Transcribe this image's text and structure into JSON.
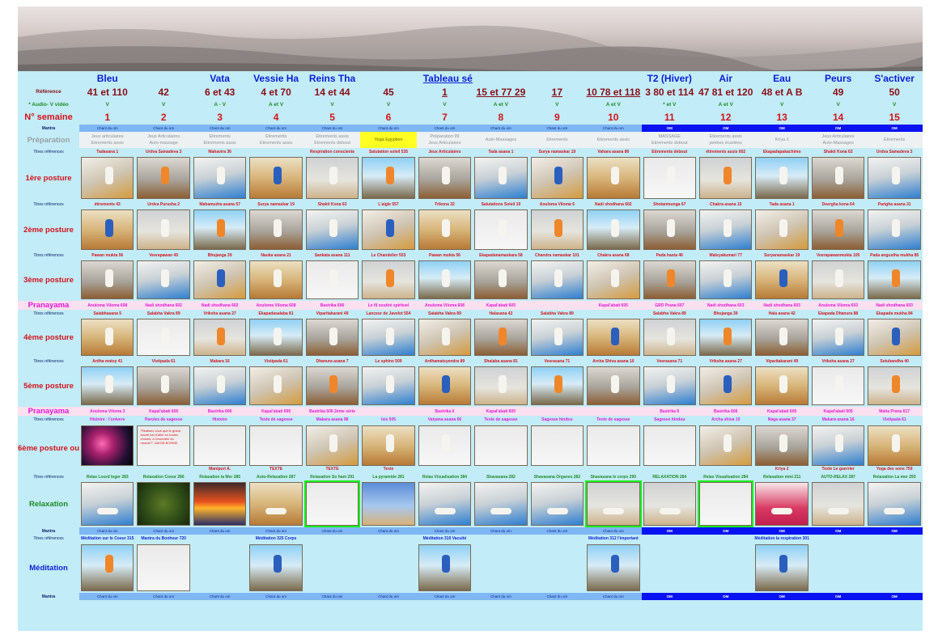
{
  "title": "Tableau séances de hatha yoga",
  "columns": [
    {
      "head": "Bleu",
      "head_color": "blue",
      "ref": "41 et 110",
      "av": "V",
      "n": "1",
      "mantra": "Chant du om",
      "prep1": "Jeux articulaires",
      "prep2": "Etirements assis",
      "t1": "Tadasana 1",
      "t2": "étirements 43",
      "t3": "Pawan mukta 56",
      "pr1": "Anuloma Viloma 608",
      "t4": "Salabhasana 5",
      "t5": "Ardha matsy 41",
      "pr2": "Anuloma Viloma 3",
      "t6": "Histoire : l'univers",
      "t6c": "",
      "t7": "Relax Lourd leger 283",
      "mantra2": "Chant du om",
      "med": "Méditation sur le Coeur 315",
      "mantra3": "Chant du om"
    },
    {
      "head": "",
      "head_color": "blue",
      "ref": "42",
      "av": "V",
      "n": "2",
      "mantra": "Chant du om",
      "prep1": "Jeux Articulaires",
      "prep2": "Auto-massage",
      "t1": "Urdva Samadeva 3",
      "t2": "Urdva Purusha 2",
      "t3": "Veerapawan 45",
      "pr1": "Nadi shodhana 602",
      "t4": "Salabha Vakra 89",
      "t5": "Vistipada 61",
      "pr2": "Kapal'abati 605",
      "t6": "Paroles de sagesse",
      "t6c": "",
      "t7": "Relaxation Coeur 286",
      "mantra2": "Chant du om",
      "med": "Mantra du Bonheur 720",
      "mantra3": "Chant du om"
    },
    {
      "head": "Vata",
      "head_color": "blue",
      "ref": "6 et 43",
      "av": "A - V",
      "n": "3",
      "mantra": "Chant du om",
      "prep1": "Etirements",
      "prep2": "Etirements assis",
      "t1": "Mahavira 36",
      "t2": "Mahamudra asana 57",
      "t3": "Bhujanga 39",
      "pr1": "Nadi shodhana 602",
      "t4": "Vriksha asana 27",
      "t5": "Makara 16",
      "pr2": "Bastrika 606",
      "t6": "Histoire",
      "t6c": "Manipuri A.",
      "t7": "Relaxation la Mer 285",
      "mantra2": "Chant du om",
      "med": "",
      "mantra3": "Chant du om"
    },
    {
      "head": "Vessie Ha",
      "head_color": "blue",
      "ref": "4 et 70",
      "av": "A et V",
      "n": "4",
      "mantra": "Chant du om",
      "prep1": "Etirements",
      "prep2": "Etirements assis",
      "t1": "",
      "t2": "Surya namaskar 19",
      "t3": "Nauka asana 21",
      "pr1": "Anuloma Viloma 608",
      "t4": "Ekapadasalaba 81",
      "t5": "Vistipada 61",
      "pr2": "Kapal'abati 605",
      "t6": "Texte de sagesse",
      "t6c": "TEXTE",
      "t7": "Auto-Relaxation 287",
      "mantra2": "Chant du om",
      "med": "Méditation 325 Corps",
      "mantra3": "Chant du om"
    },
    {
      "head": "Reins Tha",
      "head_color": "blue",
      "ref": "14 et 44",
      "av": "V",
      "n": "5",
      "mantra": "Chant du om",
      "prep1": "Etirements assis",
      "prep2": "Etirements debout",
      "t1": "Respiration consciente",
      "t2": "Shakti Kona 63",
      "t3": "Sankata asana 111",
      "pr1": "Bastrika 606",
      "t4": "Viparitakarani 49",
      "t5": "Dhanura asana 7",
      "pr2": "Bastrika 606 2ème série",
      "t6": "Makara asana 98",
      "t6c": "TEXTE",
      "t7": "Relaxation So ham 291",
      "mantra2": "Chant du om",
      "med": "",
      "mantra3": "Chant du om"
    },
    {
      "head": "",
      "head_color": "blue",
      "ref": "45",
      "av": "V",
      "n": "6",
      "mantra": "Chant du om",
      "prep1": "Yoga Egyptien",
      "prep2": "",
      "t1": "Salutation soleil 535",
      "t2": "L'aigle 557",
      "t3": "Le Chandelier 553",
      "pr1": "Le fil soutiré spirituel",
      "t4": "Lanceur de Javelot 554",
      "t5": "Le sphinx 509",
      "pr2": "",
      "t6": "Isis 505",
      "t6c": "Texte",
      "t7": "La pyramide 281",
      "mantra2": "Chant du om",
      "med": "",
      "mantra3": "Chant du om"
    },
    {
      "head": "",
      "head_color": "blue",
      "ref": "1",
      "av": "V",
      "n": "7",
      "mantra": "Chant du om",
      "prep1": "Préparation 99",
      "prep2": "Jeux Articulaires",
      "t1": "Jeux Articulaires",
      "t2": "Trikona 32",
      "t3": "Pawan mukta 56",
      "pr1": "Anuloma Viloma 608",
      "t4": "Salabha Vakra 89",
      "t5": "Ardhamatsyendra 89",
      "pr2": "Bastrika 6",
      "t6": "Vatyana asana 66",
      "t6c": "",
      "t7": "Relax Visualisation 284",
      "mantra2": "Chant du om",
      "med": "Méditation 310 Vacuité",
      "mantra3": "Chant du om"
    },
    {
      "head": "",
      "head_color": "blue",
      "ref": "15 et 77 29",
      "av": "A et V",
      "n": "8",
      "mantra": "Chant du om",
      "prep1": "Auto-Massages",
      "prep2": "",
      "t1": "Tada asana 1",
      "t2": "Salutations Soleil 19",
      "t3": "Ekapadanamaskara 58",
      "pr1": "Kapal'abati 605",
      "t4": "Halasana 42",
      "t5": "Shalaba asana 81",
      "pr2": "Kapal'abati 605",
      "t6": "Texte de sagesse",
      "t6c": "",
      "t7": "Shavasana 282",
      "mantra2": "Chant du om",
      "med": "",
      "mantra3": "Chant du om"
    },
    {
      "head": "",
      "head_color": "blue",
      "ref": "17",
      "av": "V",
      "n": "9",
      "mantra": "Chant du om",
      "prep1": "Etirements",
      "prep2": "",
      "t1": "Surya namaskar 19",
      "t2": "Anuloma Viloma 6",
      "t3": "Chandra namaskar 101",
      "pr1": "",
      "t4": "Salabha Vakra 89",
      "t5": "Veerasana 71",
      "pr2": "",
      "t6": "Sagesse hindou",
      "t6c": "",
      "t7": "Shavasana Organes 282",
      "mantra2": "Chant du om",
      "med": "",
      "mantra3": "Chant du om"
    },
    {
      "head": "",
      "head_color": "blue",
      "ref": "10 78 et 118",
      "av": "A et V",
      "n": "10",
      "mantra": "Chant du om",
      "prep1": "",
      "prep2": "Etirements assis",
      "t1": "Vahara asana 86",
      "t2": "Nadi shodhana 602",
      "t3": "Chakra asana 68",
      "pr1": "Kapal'abati 605",
      "t4": "",
      "t5": "Archa Shiva asana 10",
      "pr2": "",
      "t6": "Texte de sagesse",
      "t6c": "",
      "t7": "Shavasana le corps 290",
      "mantra2": "Chant du om",
      "med": "Méditation 312 l'important",
      "mantra3": "Chant du om"
    },
    {
      "head": "T2 (Hiver)",
      "head_color": "blue",
      "ref": "3 80 et 114",
      "av": "* et V",
      "n": "11",
      "mantra": "OM",
      "prep1": "MASSAGE",
      "prep2": "Etirements debout",
      "t1": "Etirements debout",
      "t2": "Shotanmunga 67",
      "t3": "Pada hasta 46",
      "pr1": "GRD Prana 607",
      "t4": "Salabha Vakra 89",
      "t5": "Veerasana 71",
      "pr2": "Bastrika 6",
      "t6": "Sagesse hindou",
      "t6c": "",
      "t7": "RELAXATION 284",
      "mantra2": "OM",
      "med": "",
      "mantra3": "OM"
    },
    {
      "head": "Air",
      "head_color": "blue",
      "ref": "47 81 et 120",
      "av": "A et V",
      "n": "12",
      "mantra": "OM",
      "prep1": "Etirements assis",
      "prep2": "jambes écartées",
      "t1": "étirements assis 602",
      "t2": "Chakra asana 15",
      "t3": "Matsyakumari 77",
      "pr1": "Nadi shodhana 603",
      "t4": "Bhujanga 39",
      "t5": "Vriksha asana 27",
      "pr2": "Bastrika 606",
      "t6": "Archa shiva 10",
      "t6c": "",
      "t7": "Relax Visualisation 284",
      "mantra2": "OM",
      "med": "",
      "mantra3": "OM"
    },
    {
      "head": "Eau",
      "head_color": "blue",
      "ref": "48 et A B",
      "av": "V",
      "n": "13",
      "mantra": "OM",
      "prep1": "Kriya 1",
      "prep2": "",
      "t1": "Ekapadapakachimo",
      "t2": "Tada asana 1",
      "t3": "Suryanamaskar 19",
      "pr1": "Nadi shodhana 603",
      "t4": "Hala asana 42",
      "t5": "Viparitakarani 49",
      "pr2": "Kapal'abati 605",
      "t6": "Naga asana 37",
      "t6c": "Kriya 2",
      "t7": "Relaxation mini 211",
      "mantra2": "OM",
      "med": "Méditation la respiration 301",
      "mantra3": "OM"
    },
    {
      "head": "Peurs",
      "head_color": "blue",
      "ref": "49",
      "av": "V",
      "n": "14",
      "mantra": "OM",
      "prep1": "Jeux Articulaires",
      "prep2": "Auto-Massages",
      "t1": "Shakti Kona 63",
      "t2": "Deergha kona 64",
      "t3": "Veerapawanmukta 105",
      "pr1": "Anuloma Viloma 603",
      "t4": "Ekapada Dhanura 88",
      "t5": "Vriksha asana 27",
      "pr2": "Kapal'abati 605",
      "t6": "Makara asana 16",
      "t6c": "Texte Le guerrier",
      "t7": "AUTO-RELAX 287",
      "mantra2": "OM",
      "med": "",
      "mantra3": "OM"
    },
    {
      "head": "S'activer",
      "head_color": "blue",
      "ref": "50",
      "av": "V",
      "n": "15",
      "mantra": "OM",
      "prep1": "Etirements",
      "prep2": "",
      "t1": "Urdva Samadeva 3",
      "t2": "Parigha asana 31",
      "t3": "Pada angustha mukha 85",
      "pr1": "Nadi shodhana 603",
      "t4": "Ekapada mukha 84",
      "t5": "Setubandha 40",
      "pr2": "Maha Prana 617",
      "t6": "Vistipada 61",
      "t6c": "Yoga des sons 759",
      "t7": "Relaxation La mer 293",
      "mantra2": "OM",
      "med": "",
      "mantra3": "OM"
    }
  ],
  "row_labels": {
    "reference": "Référence",
    "audio": "* Audio- V vidéo",
    "semaine": "N° semaine",
    "mantra": "Mantra",
    "preparation": "Préparation",
    "titres": "Titres références",
    "posture1": "1ère posture",
    "posture2": "2ème posture",
    "posture3": "3ème posture",
    "pranayama": "Pranayama",
    "posture4": "4ème posture",
    "posture5": "5ème posture",
    "posture6": "6ème posture ou texte",
    "relaxation": "Relaxation",
    "meditation": "Méditation"
  },
  "texts": {
    "quote": "\"Réalisez vous que le grand secret est d'aller en toutes choses, à l'essentiel du monde?\" JAKOB BOHME",
    "doc_note": "Nadi shodhana"
  },
  "colors": {
    "background": "#c2ecf7",
    "mantra_bar": "#7fb6f4",
    "om_bar": "#0913f2",
    "head_blue": "#0b1fd6",
    "ref_maroon": "#8a0e18",
    "green": "#1f8a24",
    "magenta": "#e01ad4",
    "red": "#d4141c"
  }
}
